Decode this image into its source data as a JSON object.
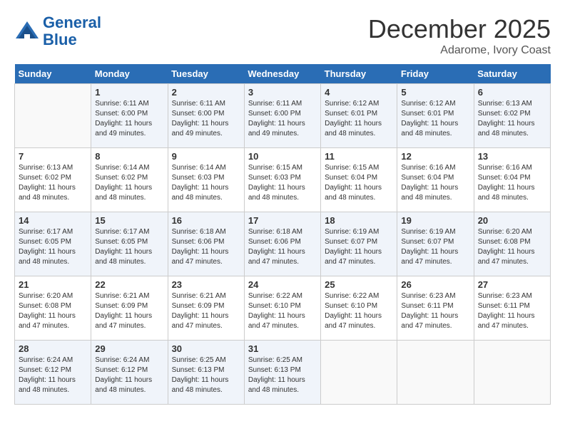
{
  "header": {
    "logo_line1": "General",
    "logo_line2": "Blue",
    "month": "December 2025",
    "location": "Adarome, Ivory Coast"
  },
  "days_of_week": [
    "Sunday",
    "Monday",
    "Tuesday",
    "Wednesday",
    "Thursday",
    "Friday",
    "Saturday"
  ],
  "weeks": [
    [
      {
        "day": "",
        "info": ""
      },
      {
        "day": "1",
        "info": "Sunrise: 6:11 AM\nSunset: 6:00 PM\nDaylight: 11 hours\nand 49 minutes."
      },
      {
        "day": "2",
        "info": "Sunrise: 6:11 AM\nSunset: 6:00 PM\nDaylight: 11 hours\nand 49 minutes."
      },
      {
        "day": "3",
        "info": "Sunrise: 6:11 AM\nSunset: 6:00 PM\nDaylight: 11 hours\nand 49 minutes."
      },
      {
        "day": "4",
        "info": "Sunrise: 6:12 AM\nSunset: 6:01 PM\nDaylight: 11 hours\nand 48 minutes."
      },
      {
        "day": "5",
        "info": "Sunrise: 6:12 AM\nSunset: 6:01 PM\nDaylight: 11 hours\nand 48 minutes."
      },
      {
        "day": "6",
        "info": "Sunrise: 6:13 AM\nSunset: 6:02 PM\nDaylight: 11 hours\nand 48 minutes."
      }
    ],
    [
      {
        "day": "7",
        "info": "Sunrise: 6:13 AM\nSunset: 6:02 PM\nDaylight: 11 hours\nand 48 minutes."
      },
      {
        "day": "8",
        "info": "Sunrise: 6:14 AM\nSunset: 6:02 PM\nDaylight: 11 hours\nand 48 minutes."
      },
      {
        "day": "9",
        "info": "Sunrise: 6:14 AM\nSunset: 6:03 PM\nDaylight: 11 hours\nand 48 minutes."
      },
      {
        "day": "10",
        "info": "Sunrise: 6:15 AM\nSunset: 6:03 PM\nDaylight: 11 hours\nand 48 minutes."
      },
      {
        "day": "11",
        "info": "Sunrise: 6:15 AM\nSunset: 6:04 PM\nDaylight: 11 hours\nand 48 minutes."
      },
      {
        "day": "12",
        "info": "Sunrise: 6:16 AM\nSunset: 6:04 PM\nDaylight: 11 hours\nand 48 minutes."
      },
      {
        "day": "13",
        "info": "Sunrise: 6:16 AM\nSunset: 6:04 PM\nDaylight: 11 hours\nand 48 minutes."
      }
    ],
    [
      {
        "day": "14",
        "info": "Sunrise: 6:17 AM\nSunset: 6:05 PM\nDaylight: 11 hours\nand 48 minutes."
      },
      {
        "day": "15",
        "info": "Sunrise: 6:17 AM\nSunset: 6:05 PM\nDaylight: 11 hours\nand 48 minutes."
      },
      {
        "day": "16",
        "info": "Sunrise: 6:18 AM\nSunset: 6:06 PM\nDaylight: 11 hours\nand 47 minutes."
      },
      {
        "day": "17",
        "info": "Sunrise: 6:18 AM\nSunset: 6:06 PM\nDaylight: 11 hours\nand 47 minutes."
      },
      {
        "day": "18",
        "info": "Sunrise: 6:19 AM\nSunset: 6:07 PM\nDaylight: 11 hours\nand 47 minutes."
      },
      {
        "day": "19",
        "info": "Sunrise: 6:19 AM\nSunset: 6:07 PM\nDaylight: 11 hours\nand 47 minutes."
      },
      {
        "day": "20",
        "info": "Sunrise: 6:20 AM\nSunset: 6:08 PM\nDaylight: 11 hours\nand 47 minutes."
      }
    ],
    [
      {
        "day": "21",
        "info": "Sunrise: 6:20 AM\nSunset: 6:08 PM\nDaylight: 11 hours\nand 47 minutes."
      },
      {
        "day": "22",
        "info": "Sunrise: 6:21 AM\nSunset: 6:09 PM\nDaylight: 11 hours\nand 47 minutes."
      },
      {
        "day": "23",
        "info": "Sunrise: 6:21 AM\nSunset: 6:09 PM\nDaylight: 11 hours\nand 47 minutes."
      },
      {
        "day": "24",
        "info": "Sunrise: 6:22 AM\nSunset: 6:10 PM\nDaylight: 11 hours\nand 47 minutes."
      },
      {
        "day": "25",
        "info": "Sunrise: 6:22 AM\nSunset: 6:10 PM\nDaylight: 11 hours\nand 47 minutes."
      },
      {
        "day": "26",
        "info": "Sunrise: 6:23 AM\nSunset: 6:11 PM\nDaylight: 11 hours\nand 47 minutes."
      },
      {
        "day": "27",
        "info": "Sunrise: 6:23 AM\nSunset: 6:11 PM\nDaylight: 11 hours\nand 47 minutes."
      }
    ],
    [
      {
        "day": "28",
        "info": "Sunrise: 6:24 AM\nSunset: 6:12 PM\nDaylight: 11 hours\nand 48 minutes."
      },
      {
        "day": "29",
        "info": "Sunrise: 6:24 AM\nSunset: 6:12 PM\nDaylight: 11 hours\nand 48 minutes."
      },
      {
        "day": "30",
        "info": "Sunrise: 6:25 AM\nSunset: 6:13 PM\nDaylight: 11 hours\nand 48 minutes."
      },
      {
        "day": "31",
        "info": "Sunrise: 6:25 AM\nSunset: 6:13 PM\nDaylight: 11 hours\nand 48 minutes."
      },
      {
        "day": "",
        "info": ""
      },
      {
        "day": "",
        "info": ""
      },
      {
        "day": "",
        "info": ""
      }
    ]
  ]
}
